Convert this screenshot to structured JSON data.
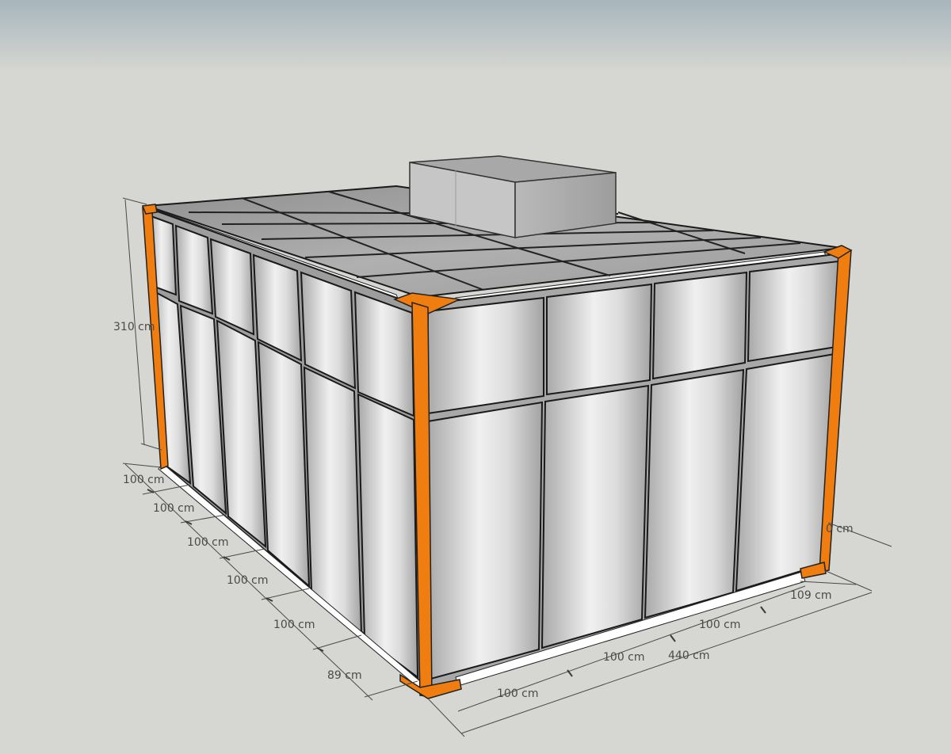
{
  "model": {
    "height_label": "310 cm",
    "side_segments": [
      "100 cm",
      "100 cm",
      "100 cm",
      "100 cm",
      "100 cm",
      "89 cm"
    ],
    "front_segments": [
      "100 cm",
      "100 cm",
      "100 cm",
      "109 cm"
    ],
    "front_total": "440 cm",
    "partial_label": "0 cm"
  },
  "colors": {
    "background": "#d6d6d2",
    "sky_top": "#a9b8bd",
    "frame_orange": "#f07d10",
    "panel_light": "#ececec",
    "panel_dark": "#a8a8a8",
    "roof_panel": "#9a9a9a",
    "trim_white": "#ffffff",
    "dimension_line": "#4a4a4a"
  }
}
